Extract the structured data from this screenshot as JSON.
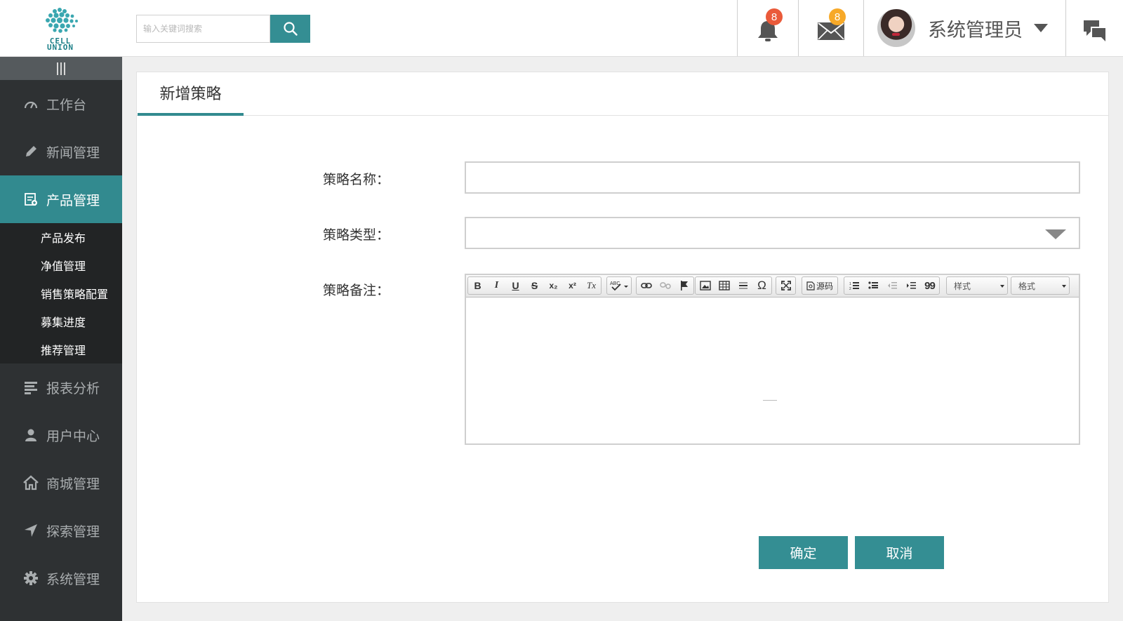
{
  "brand": {
    "logo_text": "CELL UNION",
    "accent": "#348e93"
  },
  "search": {
    "placeholder": "输入关键词搜索",
    "value": ""
  },
  "notifications": {
    "bell_count": "8",
    "mail_count": "8"
  },
  "user": {
    "name": "系统管理员"
  },
  "sidebar": {
    "items": [
      {
        "label": "工作台",
        "icon": "dashboard-icon"
      },
      {
        "label": "新闻管理",
        "icon": "pencil-icon"
      },
      {
        "label": "产品管理",
        "icon": "product-icon",
        "active": true
      },
      {
        "label": "报表分析",
        "icon": "report-icon"
      },
      {
        "label": "用户中心",
        "icon": "user-icon"
      },
      {
        "label": "商城管理",
        "icon": "home-icon"
      },
      {
        "label": "探索管理",
        "icon": "navigation-icon"
      },
      {
        "label": "系统管理",
        "icon": "gear-icon"
      }
    ],
    "sub_items": [
      {
        "label": "产品发布"
      },
      {
        "label": "净值管理"
      },
      {
        "label": "销售策略配置"
      },
      {
        "label": "募集进度"
      },
      {
        "label": "推荐管理"
      }
    ]
  },
  "panel": {
    "tab": "新增策略"
  },
  "form": {
    "name_label": "策略名称：",
    "name_value": "",
    "type_label": "策略类型：",
    "type_value": "",
    "note_label": "策略备注："
  },
  "editor": {
    "buttons": {
      "bold": "B",
      "italic": "I",
      "underline": "U",
      "strike": "S",
      "subscript": "x₂",
      "superscript": "x²",
      "remove_format": "Tx",
      "source": "源码",
      "blockquote": "99",
      "special_char": "Ω"
    },
    "style_combo": "样式",
    "format_combo": "格式"
  },
  "actions": {
    "confirm": "确定",
    "cancel": "取消"
  }
}
